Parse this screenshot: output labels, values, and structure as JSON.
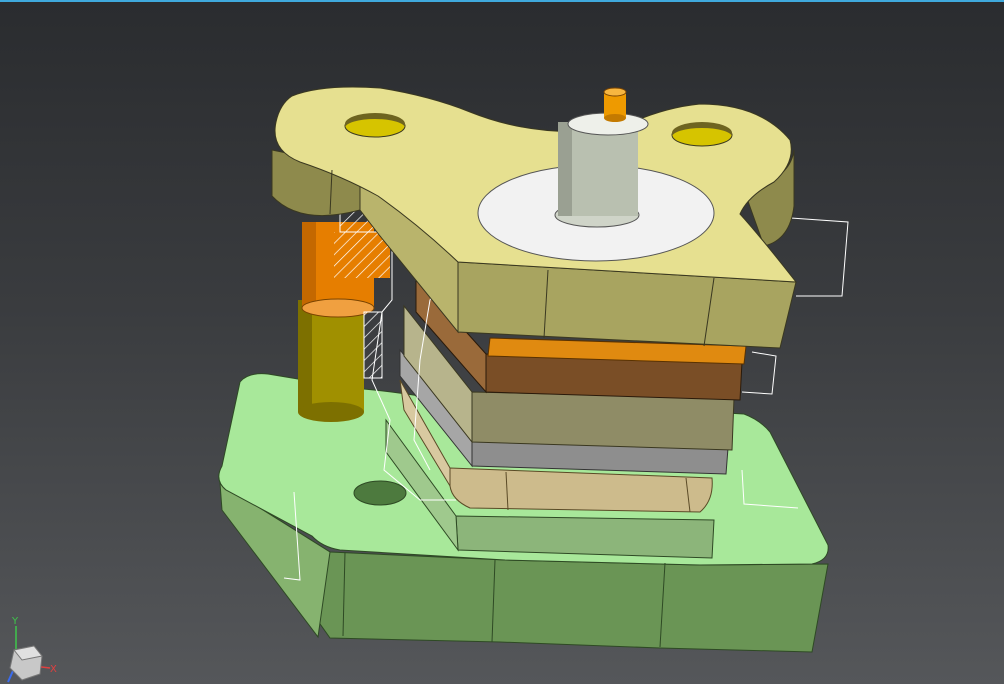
{
  "viewport": {
    "background_top": "#2a2c2f",
    "background_bottom": "#55575a",
    "accent_strip_color": "#3fa9dd"
  },
  "model": {
    "parts": [
      {
        "name": "top-plate",
        "color": "#e6e090"
      },
      {
        "name": "top-plate-shaded",
        "color": "#8e8a4c"
      },
      {
        "name": "top-plate-holes",
        "color": "#d6c400"
      },
      {
        "name": "center-boss-top",
        "color": "#f2f2f2"
      },
      {
        "name": "punch-shaft",
        "color": "#b9c0b0"
      },
      {
        "name": "pilot-pin",
        "color": "#ee9a00"
      },
      {
        "name": "guide-post",
        "color": "#a09000"
      },
      {
        "name": "guide-bushing",
        "color": "#e67e00"
      },
      {
        "name": "orange-plate",
        "color": "#e08a10"
      },
      {
        "name": "brown-plate",
        "color": "#7a4e26"
      },
      {
        "name": "olive-plate",
        "color": "#8f8c66"
      },
      {
        "name": "gray-plate",
        "color": "#8e8e8e"
      },
      {
        "name": "tan-die-block",
        "color": "#cdbb8c"
      },
      {
        "name": "die-shoe-top",
        "color": "#a8e89a"
      },
      {
        "name": "die-shoe-side",
        "color": "#6a9555"
      },
      {
        "name": "section-outline",
        "color": "#ffffff"
      }
    ]
  },
  "triad": {
    "y_label": "Y",
    "x_label": "X",
    "y_color": "#3ec64b",
    "x_color": "#e04040",
    "z_color": "#3a6cf0",
    "cube_color": "#c8c8c8"
  }
}
